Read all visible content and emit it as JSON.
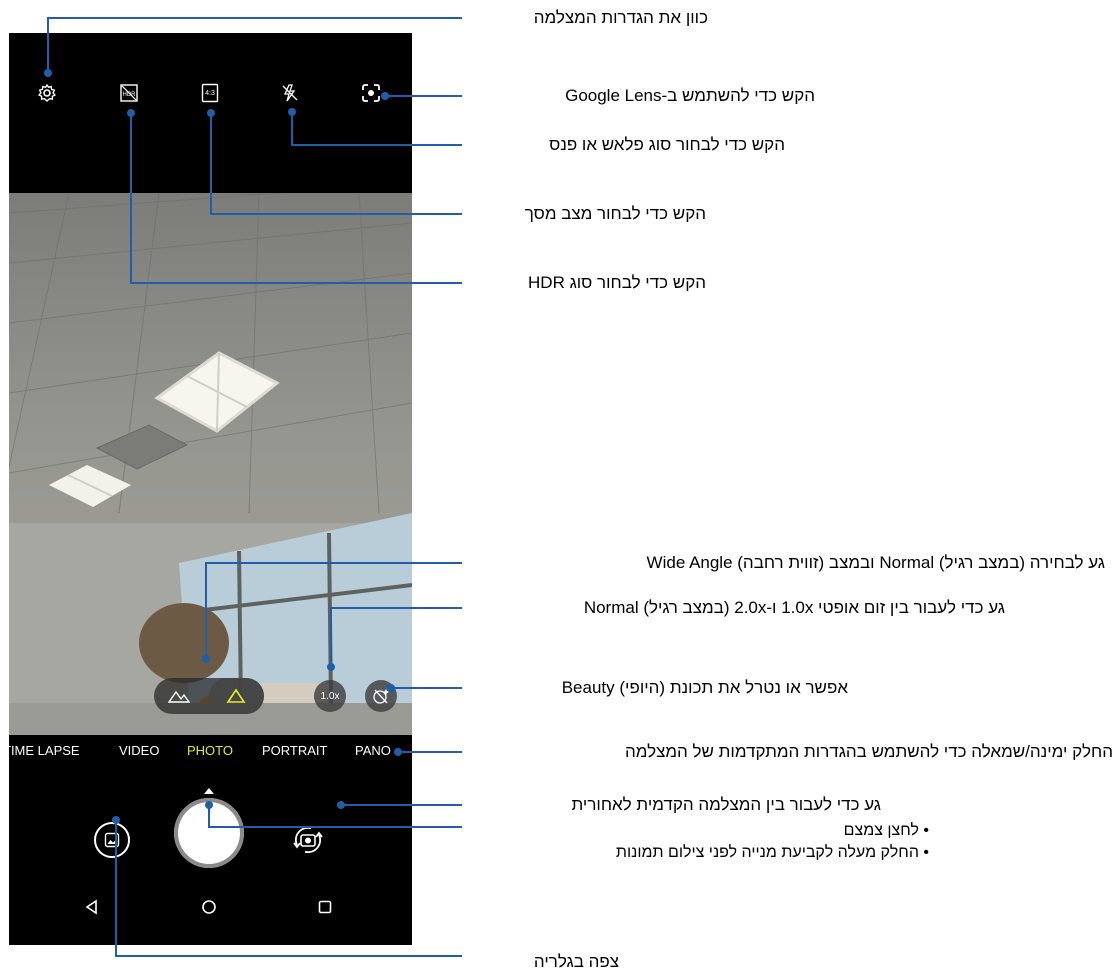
{
  "callouts": {
    "settings": "כוון את הגדרות המצלמה",
    "lens": "הקש כדי להשתמש ב-Google Lens",
    "flash": "הקש כדי לבחור סוג פלאש או פנס",
    "screen": "הקש כדי לבחור מצב מסך",
    "hdr": "הקש כדי לבחור סוג HDR",
    "angle": "גע לבחירה (במצב רגיל) Normal ובמצב (זווית רחבה) Wide Angle",
    "zoom": "גע כדי לעבור בין זום אופטי 1.0x ו-2.0x (במצב רגיל) Normal",
    "beauty": "אפשר או נטרל את תכונת (היופי) Beauty",
    "modes": "החלק ימינה/שמאלה כדי להשתמש בהגדרות המתקדמות של המצלמה",
    "switch": "גע כדי לעבור בין המצלמה הקדמית לאחורית",
    "shutter_1": "לחצן צמצם",
    "shutter_2": "החלק מעלה לקביעת מנייה לפני צילום תמונות",
    "gallery": "צפה בגלריה"
  },
  "camera": {
    "aspect_label": "4:3",
    "zoom_label": "1.0x",
    "modes": [
      "TIME LAPSE",
      "VIDEO",
      "PHOTO",
      "PORTRAIT",
      "PANO"
    ],
    "active_mode": "PHOTO"
  },
  "colors": {
    "accent": "#e4ec2a",
    "callout_line": "#1f5ea8"
  },
  "icons": [
    "settings-icon",
    "hdr-off-icon",
    "aspect-ratio-icon",
    "flash-off-icon",
    "google-lens-icon",
    "normal-angle-icon",
    "wide-angle-icon",
    "beauty-off-icon",
    "gallery-icon",
    "switch-camera-icon",
    "back-nav-icon",
    "home-nav-icon",
    "recents-nav-icon"
  ]
}
